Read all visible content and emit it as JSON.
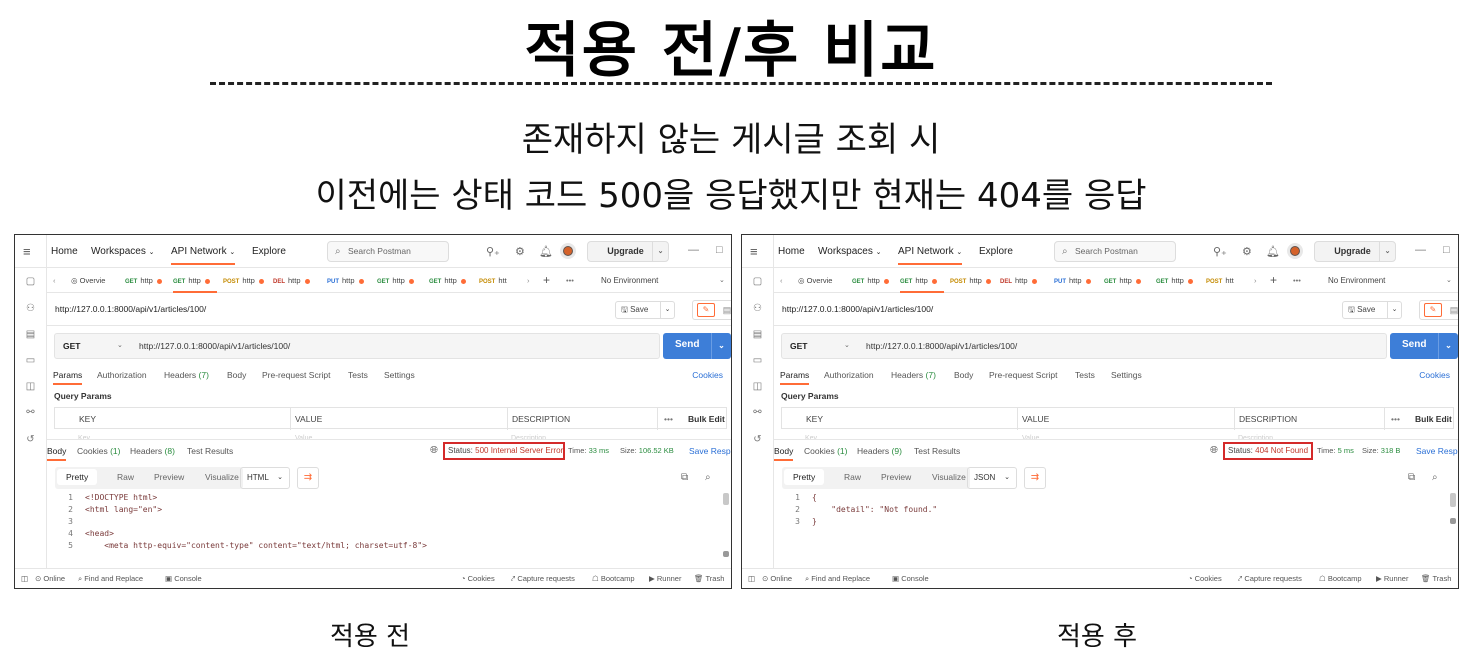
{
  "heading": {
    "title": "적용 전/후 비교",
    "line1": "존재하지 않는 게시글 조회 시",
    "line2": "이전에는 상태 코드 500을 응답했지만 현재는 404를 응답"
  },
  "captions": {
    "before": "적용 전",
    "after": "적용 후"
  },
  "accent_colors": {
    "postman_orange": "#ff6c37",
    "send_blue": "#3d7ed8",
    "highlight_red": "#d42a2a"
  },
  "app": {
    "menu_icon": "hamburger-icon",
    "nav": [
      "Home",
      "Workspaces",
      "API Network",
      "Explore"
    ],
    "search_placeholder": "Search Postman",
    "upgrade": "Upgrade",
    "tabs": [
      {
        "method": "",
        "label": "Overvie"
      },
      {
        "method": "GET",
        "label": "http"
      },
      {
        "method": "GET",
        "label": "http"
      },
      {
        "method": "POST",
        "label": "http"
      },
      {
        "method": "DEL",
        "label": "http"
      },
      {
        "method": "PUT",
        "label": "http"
      },
      {
        "method": "GET",
        "label": "http"
      },
      {
        "method": "GET",
        "label": "http"
      },
      {
        "method": "POST",
        "label": "htt"
      }
    ],
    "environment": "No Environment",
    "url": "http://127.0.0.1:8000/api/v1/articles/100/",
    "save": "Save",
    "method": "GET",
    "send": "Send",
    "request_tabs": [
      "Params",
      "Authorization",
      "Headers",
      "Body",
      "Pre-request Script",
      "Tests",
      "Settings"
    ],
    "headers_count": "(7)",
    "cookies_link": "Cookies",
    "query_params": "Query Params",
    "columns": [
      "KEY",
      "VALUE",
      "DESCRIPTION"
    ],
    "bulk_edit": "Bulk Edit",
    "ghost_row": [
      "Key",
      "Value",
      "Description"
    ],
    "response_tabs": [
      "Body",
      "Cookies",
      "Headers",
      "Test Results"
    ],
    "format_tabs": [
      "Pretty",
      "Raw",
      "Preview",
      "Visualize"
    ],
    "save_response": "Save Response",
    "footer": [
      "Online",
      "Find and Replace",
      "Console",
      "Cookies",
      "Capture requests",
      "Bootcamp",
      "Runner",
      "Trash"
    ]
  },
  "before": {
    "cookies_count": "(1)",
    "headers_count": "(8)",
    "status_label": "Status:",
    "status_value": "500 Internal Server Error",
    "time_label": "Time:",
    "time_value": "33 ms",
    "size_label": "Size:",
    "size_value": "106.52 KB",
    "format": "HTML",
    "code_lines": [
      {
        "n": "1",
        "t": "<!DOCTYPE html>"
      },
      {
        "n": "2",
        "t": "<html lang=\"en\">"
      },
      {
        "n": "3",
        "t": ""
      },
      {
        "n": "4",
        "t": "<head>"
      },
      {
        "n": "5",
        "t": "    <meta http-equiv=\"content-type\" content=\"text/html; charset=utf-8\">"
      }
    ]
  },
  "after": {
    "cookies_count": "(1)",
    "headers_count": "(9)",
    "status_label": "Status:",
    "status_value": "404 Not Found",
    "time_label": "Time:",
    "time_value": "5 ms",
    "size_label": "Size:",
    "size_value": "318 B",
    "format": "JSON",
    "code_lines": [
      {
        "n": "1",
        "t": "{"
      },
      {
        "n": "2",
        "t": "    \"detail\": \"Not found.\""
      },
      {
        "n": "3",
        "t": "}"
      }
    ]
  }
}
